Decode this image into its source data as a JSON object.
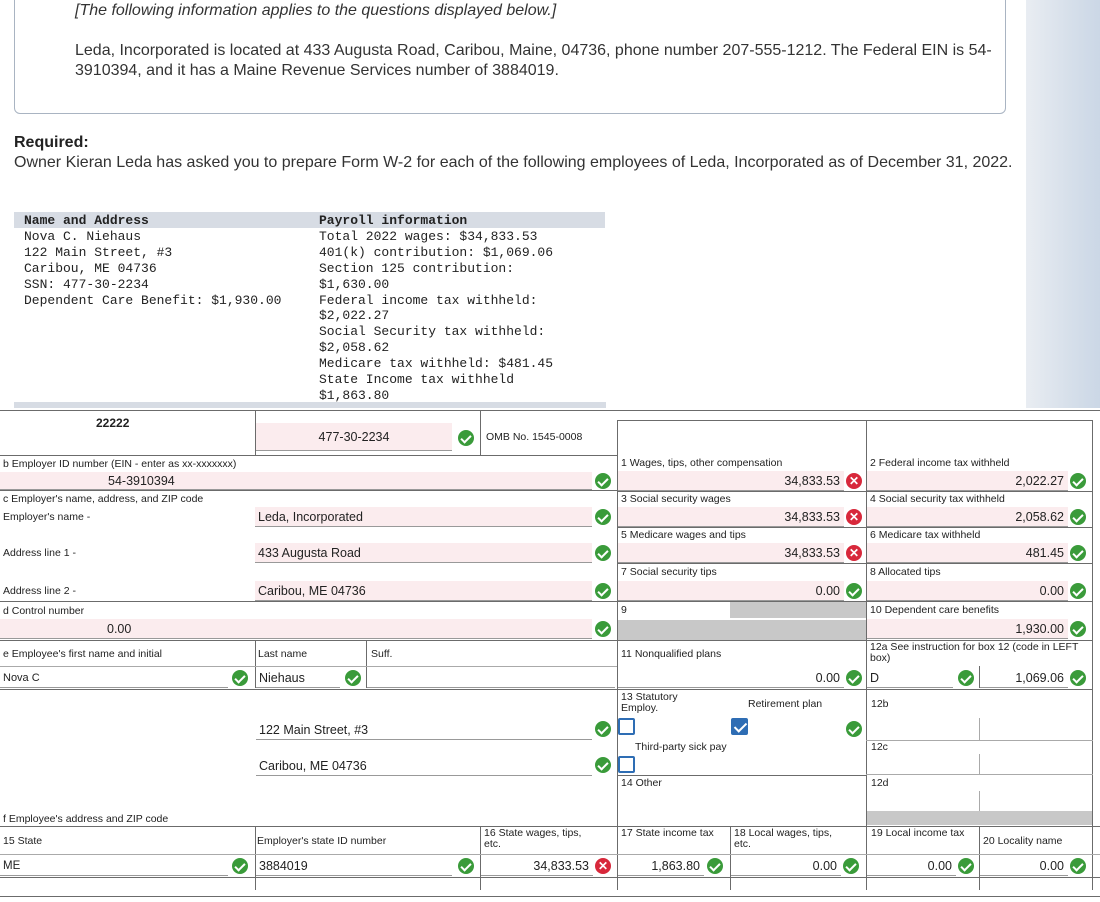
{
  "intro": {
    "italic_note": "[The following information applies to the questions displayed below.]",
    "paragraph": "Leda, Incorporated is located at 433 Augusta Road, Caribou, Maine, 04736, phone number 207-555-1212. The Federal EIN is 54-3910394, and it has a Maine Revenue Services number of 3884019."
  },
  "required": {
    "heading": "Required:",
    "text": "Owner Kieran Leda has asked you to prepare Form W-2 for each of the following employees of Leda, Incorporated as of December 31, 2022."
  },
  "employee_table": {
    "headers": [
      "Name and Address",
      "Payroll information"
    ],
    "name_lines": [
      "Nova C. Niehaus",
      "122 Main Street, #3",
      "Caribou, ME 04736",
      "SSN: 477-30-2234",
      "Dependent Care Benefit: $1,930.00"
    ],
    "payroll_lines": [
      "Total 2022 wages: $34,833.53",
      "401(k) contribution: $1,069.06",
      "Section 125 contribution:",
      "$1,630.00",
      "Federal income tax withheld:",
      "$2,022.27",
      "Social Security tax withheld:",
      "$2,058.62",
      "Medicare tax withheld: $481.45",
      "State Income tax withheld",
      "$1,863.80"
    ]
  },
  "w2": {
    "control_code": "22222",
    "ssn": "477-30-2234",
    "omb": "OMB No. 1545-0008",
    "b_label": "b  Employer ID number (EIN - enter as xx-xxxxxxx)",
    "ein": "54-3910394",
    "c_label": "c  Employer's name, address, and ZIP code",
    "employer_name_label": "Employer's name -",
    "employer_name": "Leda, Incorporated",
    "addr1_label": "Address line 1 -",
    "addr1": "433 Augusta Road",
    "addr2_label": "Address line 2 -",
    "addr2": "Caribou, ME 04736",
    "d_label": "d  Control number",
    "control_number": "0.00",
    "e_label": "e  Employee's first name and initial",
    "last_name_label": "Last name",
    "suff_label": "Suff.",
    "first_name": "Nova C",
    "last_name": "Niehaus",
    "emp_addr1": "122 Main Street, #3",
    "emp_addr2": "Caribou, ME 04736",
    "f_label": "f  Employee's address and ZIP code",
    "box1_label": "1  Wages, tips, other compensation",
    "box1": "34,833.53",
    "box2_label": "2  Federal income tax withheld",
    "box2": "2,022.27",
    "box3_label": "3  Social security wages",
    "box3": "34,833.53",
    "box4_label": "4  Social security tax withheld",
    "box4": "2,058.62",
    "box5_label": "5  Medicare wages and tips",
    "box5": "34,833.53",
    "box6_label": "6  Medicare tax withheld",
    "box6": "481.45",
    "box7_label": "7  Social security tips",
    "box7": "0.00",
    "box8_label": "8  Allocated tips",
    "box8": "0.00",
    "box9_label": "9",
    "box10_label": "10 Dependent care benefits",
    "box10": "1,930.00",
    "box11_label": "11 Nonqualified plans",
    "box11": "0.00",
    "box12a_label": "12a See instruction for box 12 (code in LEFT box)",
    "box12a_code": "D",
    "box12a_amount": "1,069.06",
    "box12b_label": "12b",
    "box12c_label": "12c",
    "box12d_label": "12d",
    "box13_label": "13 Statutory Employ.",
    "retirement_label": "Retirement plan",
    "third_party_label": "Third-party sick pay",
    "box14_label": "14 Other",
    "box15_label": "15 State",
    "state": "ME",
    "state_id_label": "Employer's state ID number",
    "state_id": "3884019",
    "box16_label": "16 State wages, tips, etc.",
    "box16": "34,833.53",
    "box17_label": "17 State income tax",
    "box17": "1,863.80",
    "box18_label": "18 Local wages, tips, etc.",
    "box18": "0.00",
    "box19_label": "19 Local income tax",
    "box19": "0.00",
    "box20_label": "20 Locality name",
    "box20": "0.00"
  },
  "colors": {
    "error": "#d8283b",
    "correct": "#3a9b3a",
    "input_bg": "#fbecee",
    "checkbox": "#2e6db4"
  }
}
